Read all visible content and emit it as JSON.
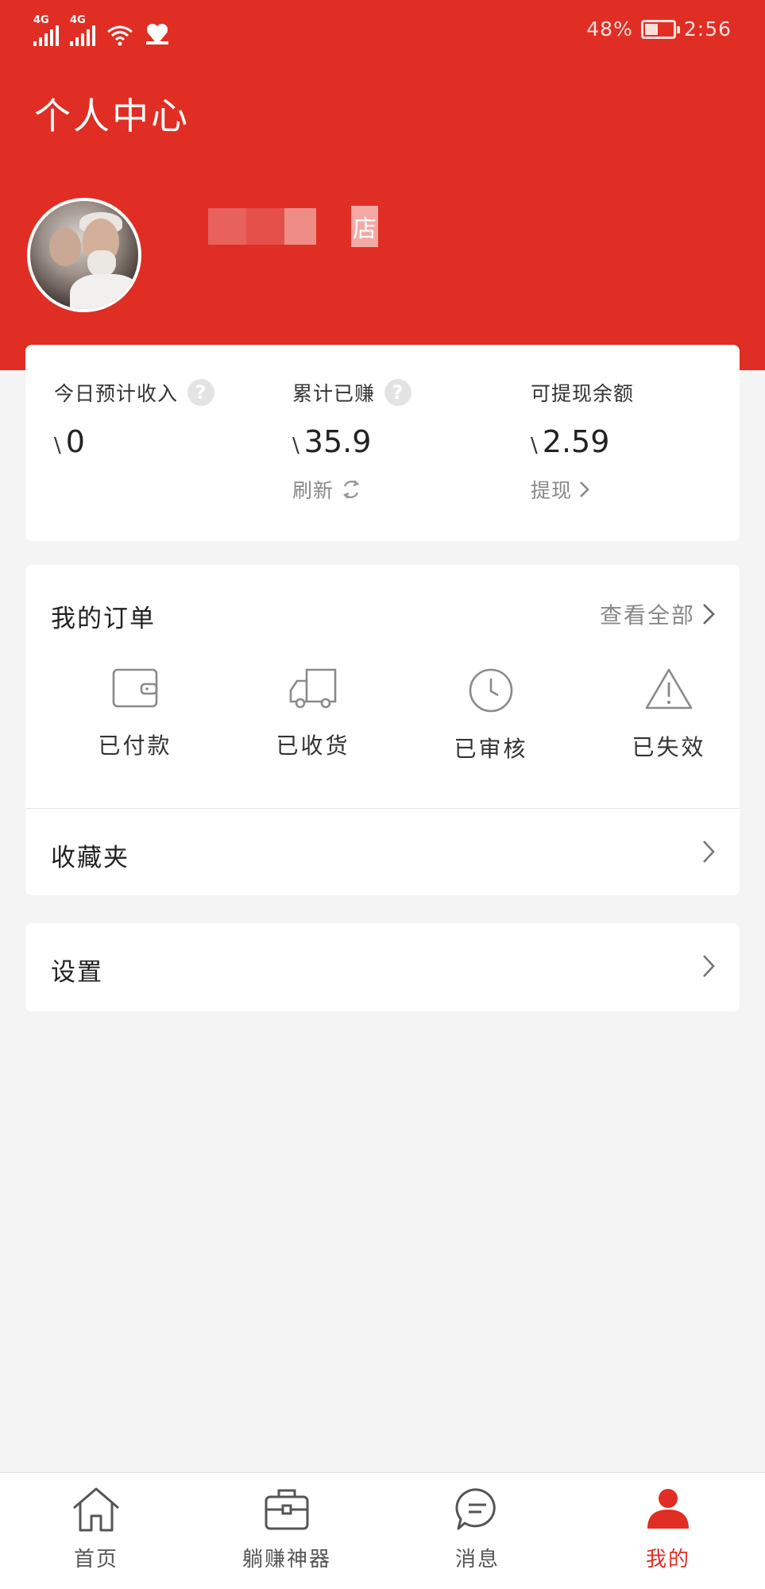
{
  "status_bar": {
    "net1": "4G",
    "net2": "4G",
    "battery_text": "48%",
    "battery_level": 0.48,
    "time": "2:56"
  },
  "header": {
    "title": "个人中心",
    "shop_name_visible": "店"
  },
  "earnings": {
    "currency": "\\",
    "today": {
      "label": "今日预计收入",
      "value": "0"
    },
    "total": {
      "label": "累计已赚",
      "value": "35.9",
      "action": "刷新"
    },
    "balance": {
      "label": "可提现余额",
      "value": "2.59",
      "action": "提现"
    }
  },
  "orders": {
    "title": "我的订单",
    "view_all": "查看全部",
    "items": [
      {
        "label": "已付款",
        "icon": "wallet-icon"
      },
      {
        "label": "已收货",
        "icon": "truck-icon"
      },
      {
        "label": "已审核",
        "icon": "clock-icon"
      },
      {
        "label": "已失效",
        "icon": "warning-icon"
      }
    ]
  },
  "menu": {
    "favorites": "收藏夹",
    "settings": "设置"
  },
  "tabbar": {
    "items": [
      {
        "label": "首页",
        "icon": "home-icon"
      },
      {
        "label": "躺赚神器",
        "icon": "briefcase-icon"
      },
      {
        "label": "消息",
        "icon": "message-icon"
      },
      {
        "label": "我的",
        "icon": "user-icon"
      }
    ],
    "active_index": 3,
    "active_color": "#e02e24"
  }
}
